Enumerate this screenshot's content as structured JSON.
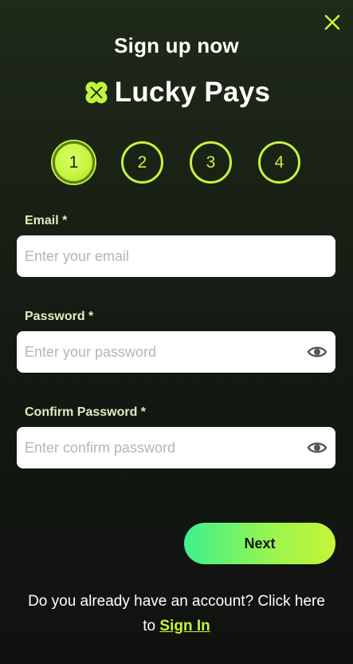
{
  "header": {
    "title": "Sign up now",
    "brand": "Lucky Pays",
    "brand_logo": "clover-logo-icon",
    "close_icon": "close-icon"
  },
  "steps": [
    {
      "label": "1",
      "active": true
    },
    {
      "label": "2",
      "active": false
    },
    {
      "label": "3",
      "active": false
    },
    {
      "label": "4",
      "active": false
    }
  ],
  "form": {
    "email": {
      "label": "Email *",
      "placeholder": "Enter your email",
      "value": ""
    },
    "password": {
      "label": "Password *",
      "placeholder": "Enter your password",
      "value": "",
      "icon": "eye-icon"
    },
    "confirm_password": {
      "label": "Confirm Password *",
      "placeholder": "Enter confirm password",
      "value": "",
      "icon": "eye-icon"
    },
    "next_label": "Next"
  },
  "footer": {
    "prompt": "Do you already have an account? Click here to",
    "signin_label": "Sign In"
  },
  "colors": {
    "accent": "#c3f53c",
    "button_gradient_start": "#3ff08e",
    "button_gradient_end": "#c6f53a",
    "background": "#161c13",
    "label": "#dcefc0"
  }
}
